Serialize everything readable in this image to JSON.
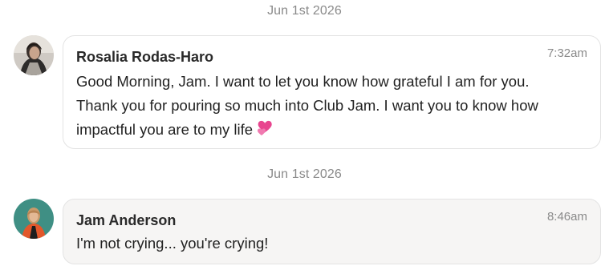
{
  "messages": [
    {
      "date": "Jun 1st 2026",
      "sender": "Rosalia Rodas-Haro",
      "time": "7:32am",
      "lines": [
        "Good Morning, Jam. I want to let you know how grateful I am for you.",
        "Thank you for pouring so much into Club Jam. I want you to know how",
        "impactful you are to my life"
      ],
      "emoji": "two-hearts-icon",
      "avatar": "avatar-photo",
      "bubble_color": "#ffffff"
    },
    {
      "date": "Jun 1st 2026",
      "sender": "Jam Anderson",
      "time": "8:46am",
      "lines": [
        "I'm not crying... you're crying!"
      ],
      "avatar": "avatar-photo",
      "bubble_color": "#f6f5f4"
    }
  ],
  "colors": {
    "muted_text": "#8a8a8a",
    "border": "#e3e3e3",
    "emoji_pink": "#e8458f"
  }
}
